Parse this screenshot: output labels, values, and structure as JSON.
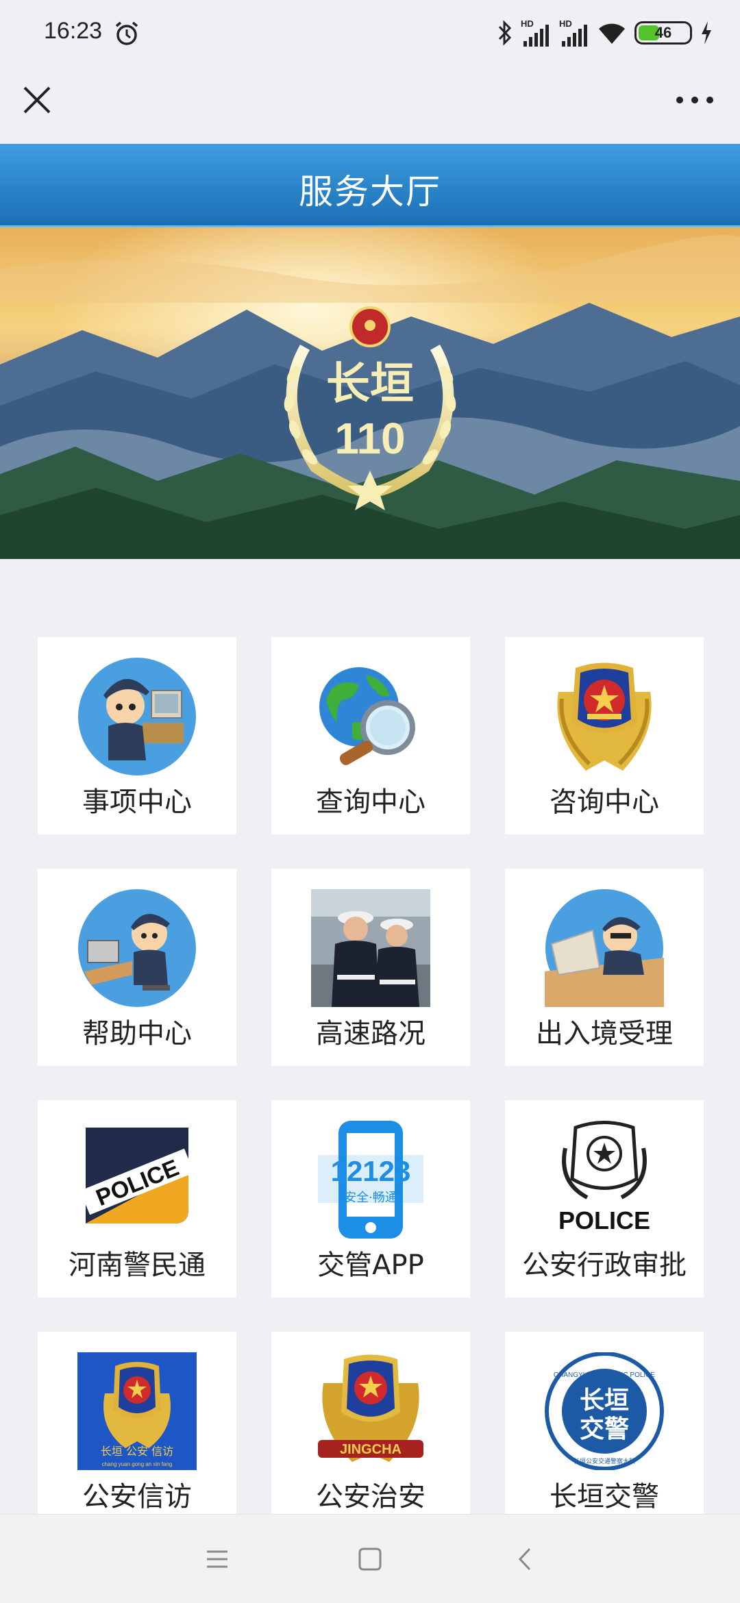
{
  "status_bar": {
    "time": "16:23",
    "battery_level": "46",
    "icons": [
      "alarm-icon",
      "bluetooth-icon",
      "signal-hd-icon",
      "signal-hd-icon",
      "wifi-icon",
      "battery-icon",
      "charging-icon"
    ]
  },
  "nav": {
    "close_icon": "close-icon",
    "more_icon": "more-icon"
  },
  "page": {
    "title": "服务大厅"
  },
  "banner": {
    "emblem_line1": "长垣",
    "emblem_line2": "110"
  },
  "services": [
    {
      "label": "事项中心",
      "icon": "officer-computer-icon"
    },
    {
      "label": "查询中心",
      "icon": "globe-search-icon"
    },
    {
      "label": "咨询中心",
      "icon": "police-emblem-icon"
    },
    {
      "label": "帮助中心",
      "icon": "officer-desk-icon"
    },
    {
      "label": "高速路况",
      "icon": "traffic-police-photo-icon"
    },
    {
      "label": "出入境受理",
      "icon": "officer-parcel-icon"
    },
    {
      "label": "河南警民通",
      "icon": "police-badge-icon"
    },
    {
      "label": "交管APP",
      "icon": "phone-12123-icon"
    },
    {
      "label": "公安行政审批",
      "icon": "police-logo-icon"
    },
    {
      "label": "公安信访",
      "icon": "petition-emblem-icon"
    },
    {
      "label": "公安治安",
      "icon": "jingcha-emblem-icon"
    },
    {
      "label": "长垣交警",
      "icon": "traffic-police-seal-icon"
    }
  ],
  "icon_text": {
    "police_badge": "POLICE",
    "phone_number": "12123",
    "phone_slogan": "安全·畅通",
    "police_logo": "POLICE",
    "petition_caption": "长垣 公安 信访",
    "petition_pinyin": "chang yuan gong an xin fang",
    "jingcha": "JINGCHA",
    "seal_line1": "长垣",
    "seal_line2": "交警",
    "seal_ring_top": "CHANGYUAN TRAFFIC POLICE",
    "seal_ring_bottom": "长垣公安交通警察大队"
  },
  "colors": {
    "title_bar_top": "#3e9de0",
    "title_bar_bottom": "#1b6fb5",
    "page_background": "#efeff4",
    "card_background": "#ffffff",
    "battery_green": "#53c22b"
  },
  "system_nav": {
    "icons": [
      "menu-icon",
      "home-icon",
      "back-icon"
    ]
  }
}
